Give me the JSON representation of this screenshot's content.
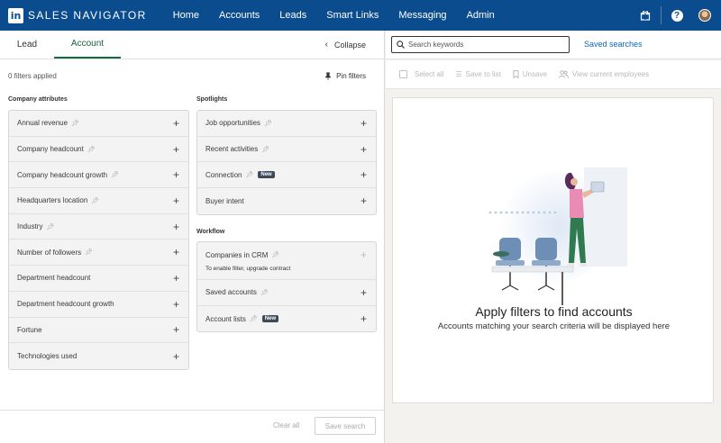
{
  "app": {
    "logo_letters": "in",
    "name": "SALES NAVIGATOR"
  },
  "topnav": {
    "items": [
      "Home",
      "Accounts",
      "Leads",
      "Smart Links",
      "Messaging",
      "Admin"
    ],
    "icons": [
      "gift-icon",
      "help-icon",
      "avatar"
    ]
  },
  "left": {
    "tabs": [
      "Lead",
      "Account"
    ],
    "active_tab": "Account",
    "collapse_label": "Collapse",
    "filters_applied": "0 filters applied",
    "pin_filters_label": "Pin filters",
    "company_attributes_title": "Company attributes",
    "company_attributes": [
      "Annual revenue",
      "Company headcount",
      "Company headcount growth",
      "Headquarters location",
      "Industry",
      "Number of followers",
      "Department headcount",
      "Department headcount growth",
      "Fortune",
      "Technologies used"
    ],
    "spotlights_title": "Spotlights",
    "spotlights": [
      {
        "label": "Job opportunities",
        "new": false
      },
      {
        "label": "Recent activities",
        "new": false
      },
      {
        "label": "Connection",
        "new": true
      },
      {
        "label": "Buyer intent",
        "new": false
      }
    ],
    "workflow_title": "Workflow",
    "workflow": {
      "crm_label": "Companies in CRM",
      "crm_note": "To enable filter, upgrade contract",
      "saved_accounts": "Saved accounts",
      "account_lists": "Account lists"
    },
    "new_badge": "New",
    "clear_all": "Clear all",
    "save_search": "Save search"
  },
  "right": {
    "search_placeholder": "Search keywords",
    "saved_searches": "Saved searches",
    "actions": [
      "Select all",
      "Save to list",
      "Unsave",
      "View current employees"
    ],
    "empty_title": "Apply filters to find accounts",
    "empty_subtitle": "Accounts matching your search criteria will be displayed here"
  },
  "colors": {
    "nav_bg": "#0a4c8e",
    "active_tab": "#14633a",
    "link": "#0a66c2",
    "new_badge": "#3d4b59"
  }
}
